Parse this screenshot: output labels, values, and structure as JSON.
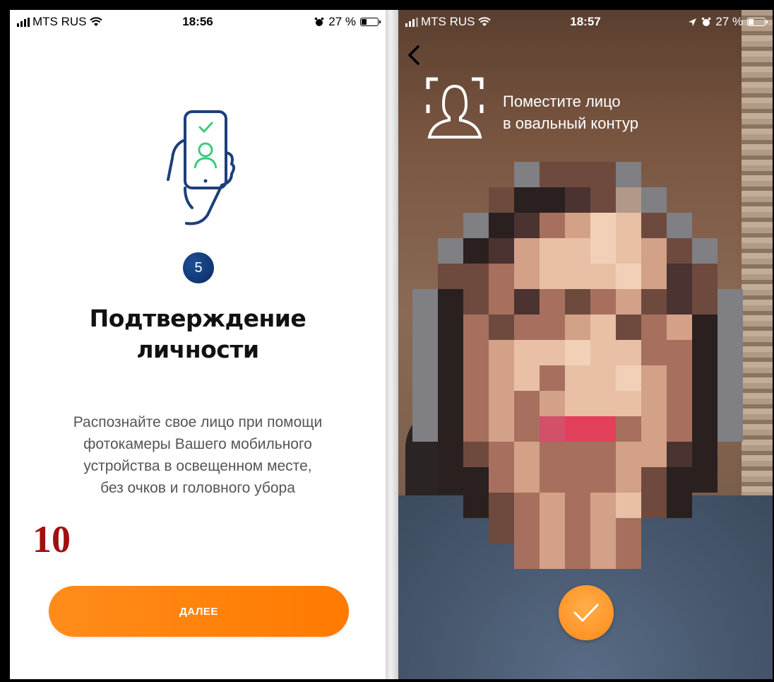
{
  "left_screen": {
    "status": {
      "carrier": "MTS RUS",
      "time": "18:56",
      "battery": "27 %"
    },
    "step_number": "5",
    "title_line1": "Подтверждение",
    "title_line2": "личности",
    "description_lines": [
      "Распознайте свое лицо при помощи",
      "фотокамеры Вашего мобильного",
      "устройства в освещенном месте,",
      "без очков и головного убора"
    ],
    "next_button": "ДАЛЕЕ"
  },
  "overlay_label": "10",
  "right_screen": {
    "status": {
      "carrier": "MTS RUS",
      "time": "18:57",
      "battery": "27 %"
    },
    "hint_line1": "Поместите лицо",
    "hint_line2": "в овальный контур"
  },
  "colors": {
    "accent_orange": "#ff8000",
    "badge_blue": "#0b2c66",
    "illustration_blue": "#1d3f7a",
    "illustration_green": "#3ecb7e",
    "label_red": "#a10f0f"
  },
  "icons": {
    "illustration": "hand-holding-phone-with-face-check",
    "back": "chevron-left-icon",
    "face_frame": "face-scan-frame-icon",
    "confirm": "checkmark-icon"
  }
}
